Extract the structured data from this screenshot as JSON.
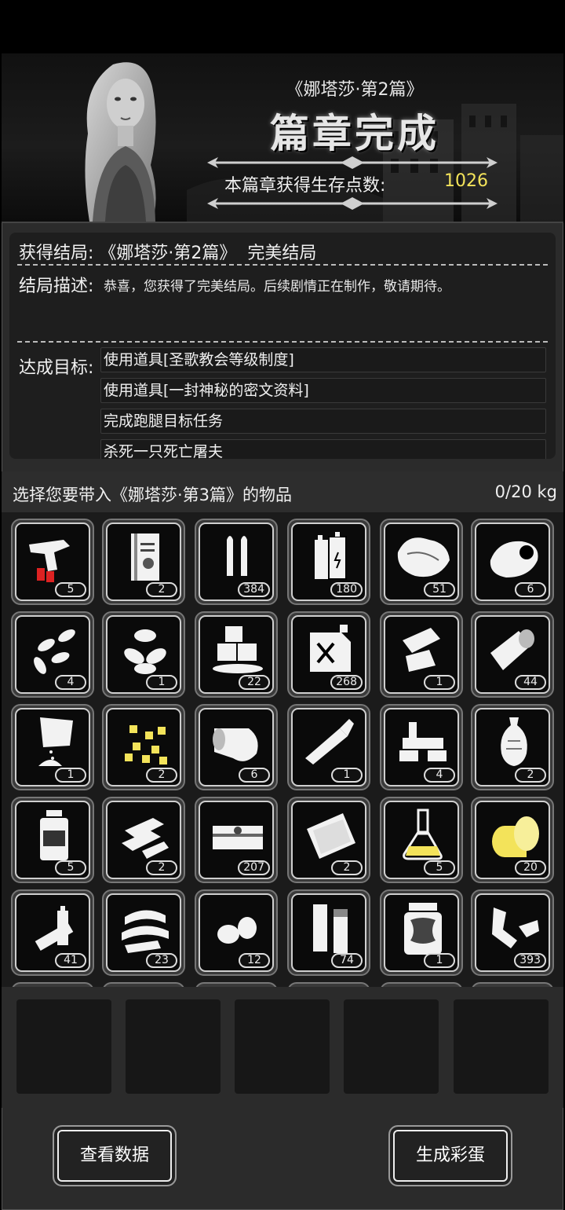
{
  "header": {
    "subtitle": "《娜塔莎·第2篇》",
    "title": "篇章完成",
    "points_label": "本篇章获得生存点数:",
    "points_value": "1026"
  },
  "ending": {
    "label": "获得结局:",
    "chapter": "《娜塔莎·第2篇》",
    "result": "完美结局",
    "desc_label": "结局描述:",
    "desc_text": "恭喜，您获得了完美结局。后续剧情正在制作，敬请期待。",
    "goals_label": "达成目标:",
    "goals": [
      "使用道具[圣歌教会等级制度]",
      "使用道具[一封神秘的密文资料]",
      "完成跑腿目标任务",
      "杀死一只死亡屠夫"
    ]
  },
  "selection": {
    "label": "选择您要带入《娜塔莎·第3篇》的物品",
    "weight": "0/20 kg"
  },
  "items": [
    {
      "icon": "flare-gun-icon",
      "count": "5"
    },
    {
      "icon": "book-icon",
      "count": "2"
    },
    {
      "icon": "bullets-icon",
      "count": "384"
    },
    {
      "icon": "batteries-icon",
      "count": "180"
    },
    {
      "icon": "meat-icon",
      "count": "51"
    },
    {
      "icon": "cloth-sack-icon",
      "count": "6"
    },
    {
      "icon": "seeds-icon",
      "count": "4"
    },
    {
      "icon": "almonds-icon",
      "count": "1"
    },
    {
      "icon": "ice-cubes-icon",
      "count": "22"
    },
    {
      "icon": "fuel-can-icon",
      "count": "268"
    },
    {
      "icon": "scrap-paper-icon",
      "count": "1"
    },
    {
      "icon": "bandage-roll-icon",
      "count": "44"
    },
    {
      "icon": "powder-bag-icon",
      "count": "1"
    },
    {
      "icon": "gold-nuggets-icon",
      "count": "2"
    },
    {
      "icon": "cloth-roll-icon",
      "count": "6"
    },
    {
      "icon": "tube-icon",
      "count": "1"
    },
    {
      "icon": "parts-icon",
      "count": "4"
    },
    {
      "icon": "vase-icon",
      "count": "2"
    },
    {
      "icon": "bottle-icon",
      "count": "5"
    },
    {
      "icon": "metal-bars-icon",
      "count": "2"
    },
    {
      "icon": "cash-stack-icon",
      "count": "207"
    },
    {
      "icon": "cloth-sheet-icon",
      "count": "2"
    },
    {
      "icon": "flask-icon",
      "count": "5"
    },
    {
      "icon": "spool-icon",
      "count": "20"
    },
    {
      "icon": "battery-cells-icon",
      "count": "41"
    },
    {
      "icon": "tape-icon",
      "count": "23"
    },
    {
      "icon": "potatoes-icon",
      "count": "12"
    },
    {
      "icon": "pipes-icon",
      "count": "74"
    },
    {
      "icon": "jar-icon",
      "count": "1"
    },
    {
      "icon": "debris-icon",
      "count": "393"
    }
  ],
  "buttons": {
    "view_data": "查看数据",
    "generate_egg": "生成彩蛋"
  },
  "colors": {
    "points": "#f3e35a",
    "item_highlight": "#f3e35a"
  }
}
